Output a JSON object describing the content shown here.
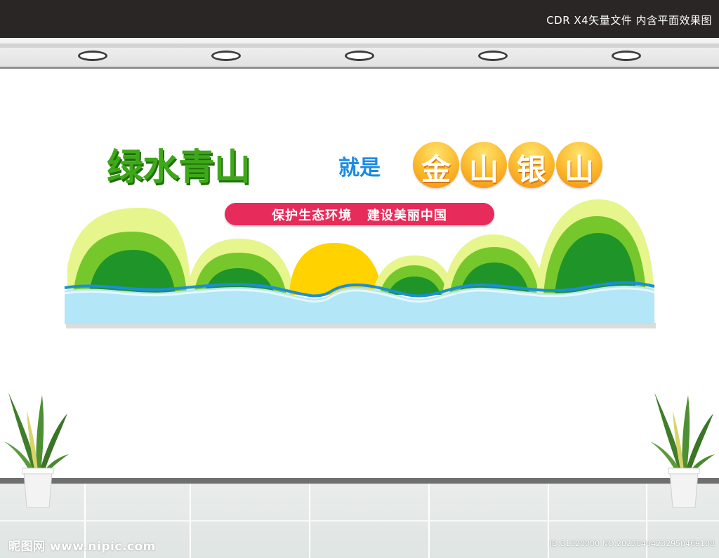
{
  "header": {
    "caption": "CDR X4矢量文件  内含平面效果图"
  },
  "sign": {
    "title_green": "绿水青山",
    "title_blue": "就是",
    "title_gold_chars": [
      "金",
      "山",
      "银",
      "山"
    ],
    "slogan": "保护生态环境   建设美丽中国"
  },
  "colors": {
    "title_green": "#3fa81a",
    "title_blue": "#1b8be3",
    "gold": "#fbb72a",
    "slogan_pill": "#e72b5a",
    "hill_light": "#e6f58c",
    "hill_mid": "#76c72b",
    "hill_dark": "#1f9428",
    "sun": "#ffd200",
    "water": "#b3e6f6",
    "wave": "#1a8fd8"
  },
  "icons": [
    "ceiling-light-icon",
    "potted-plant-icon"
  ],
  "watermark": {
    "left": "昵图网 www.nipic.com",
    "right": "ID:31320000 NO:20230404232950469108"
  }
}
